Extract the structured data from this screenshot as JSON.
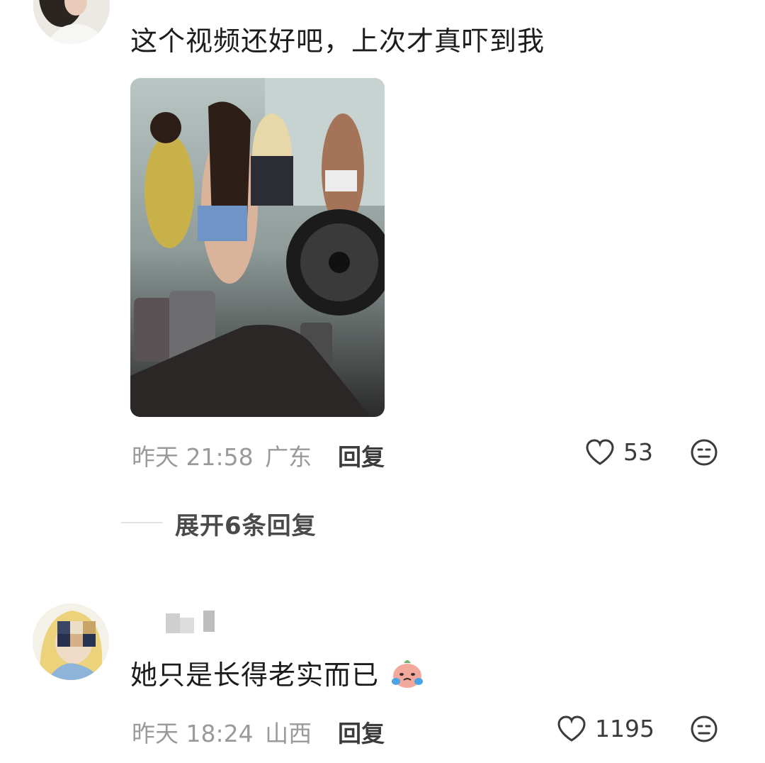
{
  "comments": [
    {
      "text": "这个视频还好吧，上次才真吓到我",
      "time": "昨天 21:58",
      "location": "广东",
      "reply_label": "回复",
      "likes": "53",
      "has_video": true
    },
    {
      "text": "她只是长得老实而已",
      "emoji": "crying-face-sticker",
      "time": "昨天 18:24",
      "location": "山西",
      "reply_label": "回复",
      "likes": "1195"
    }
  ],
  "expand_replies": "展开6条回复",
  "colors": {
    "meta": "#9a9a9a",
    "text": "#1c1c1c",
    "like_icon": "#3a3a3a"
  }
}
